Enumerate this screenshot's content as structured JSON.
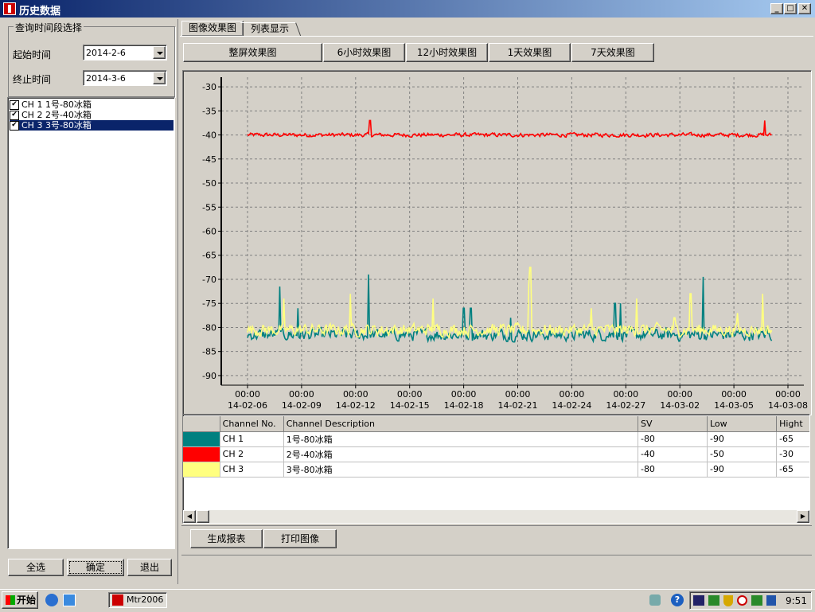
{
  "window": {
    "title": "历史数据"
  },
  "left_panel": {
    "group_title": "查询时间段选择",
    "start_label": "起始时间",
    "start_value": "2014-2-6",
    "end_label": "终止时间",
    "end_value": "2014-3-6",
    "channels": [
      {
        "label": "CH  1  1号-80冰箱",
        "checked": true,
        "selected": false
      },
      {
        "label": "CH  2  2号-40冰箱",
        "checked": true,
        "selected": false
      },
      {
        "label": "CH  3  3号-80冰箱",
        "checked": true,
        "selected": true
      }
    ],
    "buttons": {
      "select_all": "全选",
      "confirm": "确定",
      "exit": "退出"
    }
  },
  "tabs": [
    {
      "label": "图像效果图"
    },
    {
      "label": "列表显示"
    }
  ],
  "view_buttons": {
    "full": "整屏效果图",
    "h6": "6小时效果图",
    "h12": "12小时效果图",
    "d1": "1天效果图",
    "d7": "7天效果图"
  },
  "chart_data": {
    "type": "line",
    "title": "",
    "xlabel": "",
    "ylabel": "",
    "ylim": [
      -92,
      -28
    ],
    "yticks": [
      -30,
      -35,
      -40,
      -45,
      -50,
      -55,
      -60,
      -65,
      -70,
      -75,
      -80,
      -85,
      -90
    ],
    "xticks": [
      "00:00|14-02-06",
      "00:00|14-02-09",
      "00:00|14-02-12",
      "00:00|14-02-15",
      "00:00|14-02-18",
      "00:00|14-02-21",
      "00:00|14-02-24",
      "00:00|14-02-27",
      "00:00|14-03-02",
      "00:00|14-03-05",
      "00:00|14-03-08"
    ],
    "x_range_days": [
      0,
      30
    ],
    "grid": true,
    "series": [
      {
        "color": "#ff0000",
        "base": -40,
        "noise": 0.6,
        "start_day": 0,
        "end_day": 29.1,
        "spikes": [
          [
            6.8,
            -37
          ],
          [
            28.7,
            -37
          ]
        ]
      },
      {
        "color": "#008080",
        "base": -81.5,
        "noise": 1.8,
        "start_day": 0,
        "end_day": 29.1,
        "spikes": [
          [
            1.8,
            -71.5
          ],
          [
            2.8,
            -76
          ],
          [
            6.7,
            -69
          ],
          [
            12,
            -76
          ],
          [
            14.6,
            -78
          ],
          [
            20.7,
            -75
          ],
          [
            28.8,
            -80
          ],
          [
            25.3,
            -69.5
          ],
          [
            20.4,
            -75
          ],
          [
            12.4,
            -76
          ]
        ]
      },
      {
        "color": "#ffff80",
        "base": -80.5,
        "noise": 1.8,
        "start_day": 0,
        "end_day": 29.1,
        "spikes": [
          [
            2.0,
            -74
          ],
          [
            5.7,
            -73
          ],
          [
            10.3,
            -74
          ],
          [
            15.6,
            -71
          ],
          [
            15.7,
            -67.5
          ],
          [
            19.1,
            -76
          ],
          [
            21.6,
            -74
          ],
          [
            23.7,
            -78
          ],
          [
            24.6,
            -73
          ],
          [
            27.2,
            -77
          ],
          [
            28.6,
            -73
          ]
        ]
      }
    ]
  },
  "table": {
    "headers": [
      "",
      "Channel No.",
      "Channel Description",
      "SV",
      "Low",
      "Hight"
    ],
    "rows": [
      {
        "color": "#008080",
        "no": "CH  1",
        "desc": "1号-80冰箱",
        "sv": "-80",
        "low": "-90",
        "high": "-65"
      },
      {
        "color": "#ff0000",
        "no": "CH  2",
        "desc": "2号-40冰箱",
        "sv": "-40",
        "low": "-50",
        "high": "-30"
      },
      {
        "color": "#ffff80",
        "no": "CH  3",
        "desc": "3号-80冰箱",
        "sv": "-80",
        "low": "-90",
        "high": "-65"
      }
    ]
  },
  "bottom_buttons": {
    "report": "生成报表",
    "print": "打印图像"
  },
  "taskbar": {
    "start": "开始",
    "task": "Mtr2006",
    "clock": "9:51"
  }
}
